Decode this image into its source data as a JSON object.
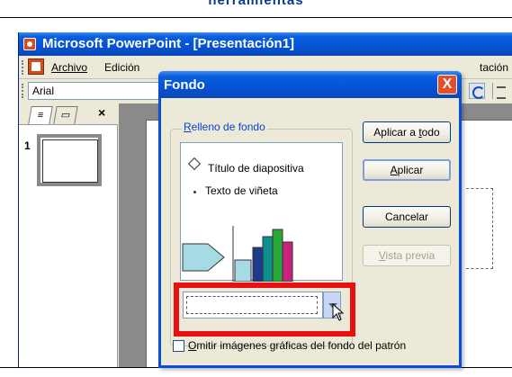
{
  "top_banner": {
    "text": "herramientas"
  },
  "app": {
    "title": "Microsoft PowerPoint - [Presentación1]",
    "menu": [
      "Archivo",
      "Edición",
      "tación"
    ],
    "font_value": "Arial"
  },
  "left_pane": {
    "tab_close": "×",
    "slide_number": "1"
  },
  "dialog": {
    "title": "Fondo",
    "close": "X",
    "group_label_pre": "",
    "group_label_u": "R",
    "group_label_post": "elleno de fondo",
    "preview_title": "Título de diapositiva",
    "preview_bullet": "Texto de viñeta",
    "checkbox_pre": "",
    "checkbox_u": "O",
    "checkbox_post": "mitir imágenes gráficas del fondo del patrón",
    "checkbox_checked": false,
    "buttons": {
      "apply_all_pre": "Aplicar a ",
      "apply_all_u": "t",
      "apply_all_post": "odo",
      "apply_u": "A",
      "apply_post": "plicar",
      "cancel": "Cancelar",
      "preview_u": "V",
      "preview_post": "ista previa"
    }
  },
  "colors": {
    "title_bar": "#0553d6",
    "highlight": "#e81010",
    "chart_bars": [
      "#1f3a8c",
      "#0e8f8c",
      "#2aa83a",
      "#c8227e"
    ],
    "chart_shapes": "#a6dbe6"
  }
}
